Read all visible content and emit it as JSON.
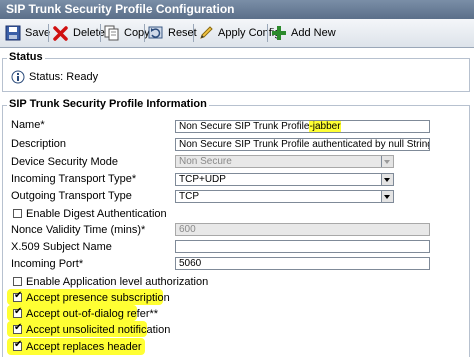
{
  "window": {
    "title": "SIP Trunk Security Profile Configuration"
  },
  "toolbar": {
    "save_label": "Save",
    "delete_label": "Delete",
    "copy_label": "Copy",
    "reset_label": "Reset",
    "apply_config_label": "Apply Config",
    "add_new_label": "Add New"
  },
  "status": {
    "legend": "Status",
    "text": "Status: Ready"
  },
  "profile": {
    "legend": "SIP Trunk Security Profile Information",
    "name_label": "Name",
    "name_value": "Non Secure SIP Trunk Profile",
    "name_value_suffix": "-jabber",
    "description_label": "Description",
    "description_value": "Non Secure SIP Trunk Profile authenticated by null String",
    "device_security_mode_label": "Device Security Mode",
    "device_security_mode_value": "Non Secure",
    "incoming_transport_label": "Incoming Transport Type",
    "incoming_transport_value": "TCP+UDP",
    "outgoing_transport_label": "Outgoing Transport Type",
    "outgoing_transport_value": "TCP",
    "digest_auth_label": "Enable Digest Authentication",
    "nonce_label": "Nonce Validity Time (mins)",
    "nonce_value": "600",
    "x509_label": "X.509 Subject Name",
    "x509_value": "",
    "incoming_port_label": "Incoming Port",
    "incoming_port_value": "5060",
    "app_level_auth_label": "Enable Application level authorization",
    "presence_sub_label": "Accept presence subscription",
    "out_of_dialog_label": "Accept out-of-dialog refer",
    "unsolicited_label": "Accept unsolicited notification",
    "replaces_label": "Accept replaces header",
    "required_marker": "*",
    "double_marker": "**"
  },
  "colors": {
    "highlight": "#ffff33",
    "titlebar": "#5b6f89"
  }
}
